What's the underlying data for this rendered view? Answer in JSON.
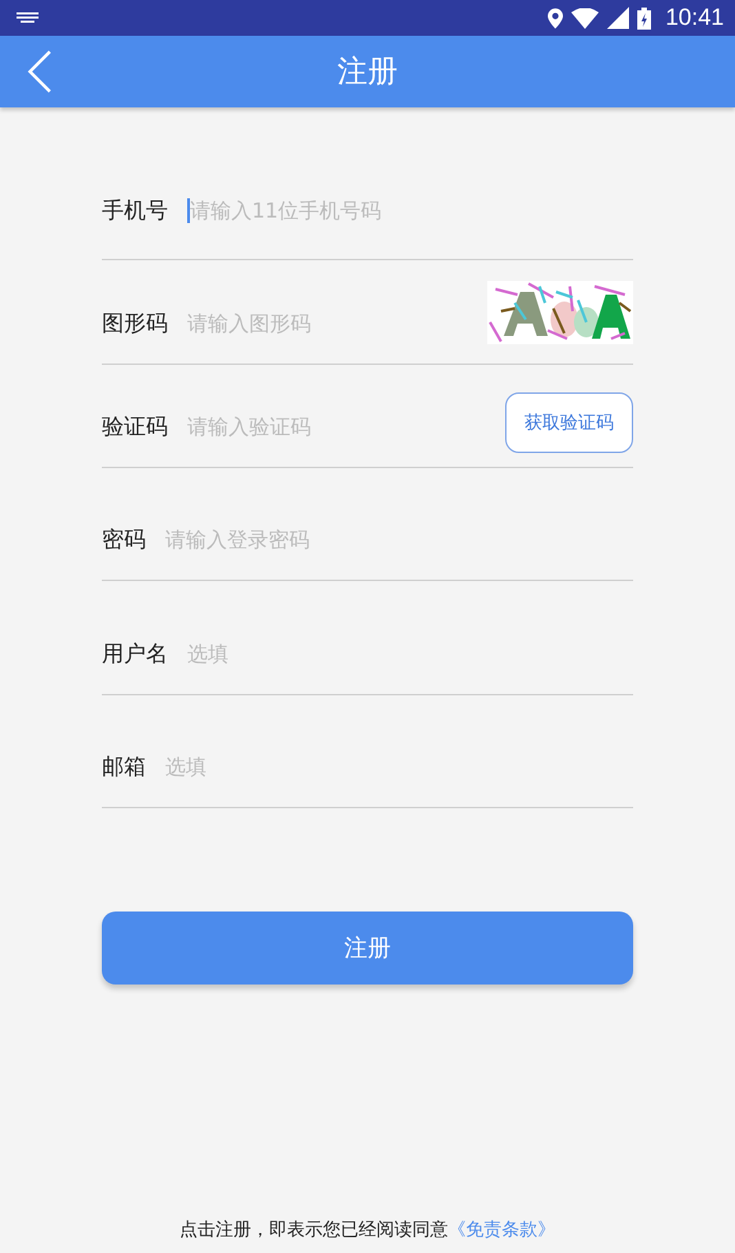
{
  "status_bar": {
    "time": "10:41"
  },
  "header": {
    "title": "注册"
  },
  "fields": [
    {
      "kind": "text",
      "label": "手机号",
      "placeholder": "请输入11位手机号码",
      "focused": true
    },
    {
      "kind": "captcha",
      "label": "图形码",
      "placeholder": "请输入图形码",
      "focused": false
    },
    {
      "kind": "sms",
      "label": "验证码",
      "placeholder": "请输入验证码",
      "focused": false,
      "button": "获取验证码"
    },
    {
      "kind": "text",
      "label": "密码",
      "placeholder": "请输入登录密码",
      "focused": false
    },
    {
      "kind": "text",
      "label": "用户名",
      "placeholder": "选填",
      "focused": false
    },
    {
      "kind": "text",
      "label": "邮箱",
      "placeholder": "选填",
      "focused": false
    }
  ],
  "submit": "注册",
  "agreement": {
    "text": "点击注册，即表示您已经阅读同意",
    "link": "《免责条款》"
  }
}
